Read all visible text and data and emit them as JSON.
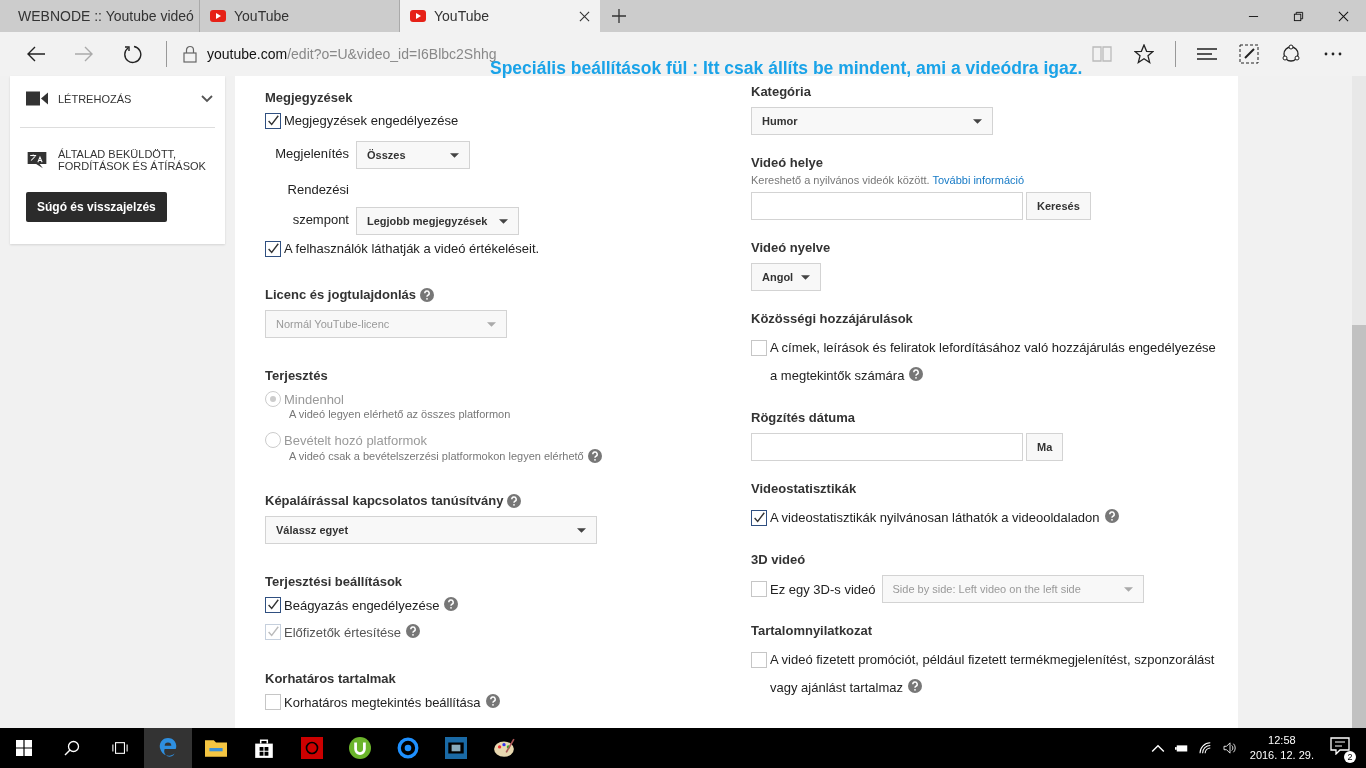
{
  "browser": {
    "tabs": [
      {
        "title": "WEBNODE :: Youtube videó",
        "kind": "webnode",
        "selected": false
      },
      {
        "title": "YouTube",
        "kind": "youtube",
        "selected": false
      },
      {
        "title": "YouTube",
        "kind": "youtube",
        "selected": true
      }
    ],
    "address": {
      "host": "youtube.com",
      "path": "/edit?o=U&video_id=I6Blbc2Shhg"
    }
  },
  "annotation": "Speciális beállítások fül : Itt csak állíts be mindent, ami a videódra igaz.",
  "sidebar": {
    "items": [
      {
        "label": "LÉTREHOZÁS",
        "kind": "create",
        "expandable": true
      },
      {
        "label": "ÁLTALAD BEKÜLDÖTT, FORDÍTÁSOK ÉS ÁTÍRÁSOK",
        "kind": "translate"
      }
    ],
    "help_button": "Súgó és visszajelzés"
  },
  "columns": [
    [
      {
        "title": "Megjegyzések",
        "controls": [
          {
            "kind": "checkbox",
            "label": "Megjegyzések engedélyezése",
            "checked": true
          },
          {
            "kind": "labeled_select",
            "label": "Megjelenítés",
            "value": "Összes"
          },
          {
            "kind": "labeled_select",
            "label": "Rendezési szempont",
            "value": "Legjobb megjegyzések"
          },
          {
            "kind": "checkbox",
            "label": "A felhasználók láthatják a videó értékeléseit.",
            "checked": true
          }
        ]
      },
      {
        "title": "Licenc és jogtulajdonlás",
        "help": true,
        "controls": [
          {
            "kind": "select",
            "value": "Normál YouTube-licenc",
            "disabled": true
          }
        ]
      },
      {
        "title": "Terjesztés",
        "controls": [
          {
            "kind": "radio",
            "label": "Mindenhol",
            "description": "A videó legyen elérhető az összes platformon",
            "selected": true,
            "disabled": true
          },
          {
            "kind": "radio",
            "label": "Bevételt hozó platformok",
            "description": "A videó csak a bevételszerzési platformokon legyen elérhető",
            "selected": false,
            "disabled": true,
            "help": true
          }
        ]
      },
      {
        "title": "Képaláírással kapcsolatos tanúsítvány",
        "help": true,
        "controls": [
          {
            "kind": "select",
            "value": "Válassz egyet",
            "wide": true
          }
        ]
      },
      {
        "title": "Terjesztési beállítások",
        "controls": [
          {
            "kind": "checkbox",
            "label": "Beágyazás engedélyezése",
            "checked": true,
            "help": true
          },
          {
            "kind": "checkbox",
            "label": "Előfizetők értesítése",
            "checked": true,
            "disabled": true,
            "help": true
          }
        ]
      },
      {
        "title": "Korhatáros tartalmak",
        "controls": [
          {
            "kind": "checkbox",
            "label": "Korhatáros megtekintés beállítása",
            "checked": false,
            "help": true
          }
        ]
      }
    ],
    [
      {
        "title": "Kategória",
        "controls": [
          {
            "kind": "select",
            "value": "Humor"
          }
        ]
      },
      {
        "title": "Videó helye",
        "controls": [
          {
            "kind": "note",
            "text": "Kereshető a nyilvános videók között.",
            "link": "További információ"
          },
          {
            "kind": "field_button",
            "button": "Keresés"
          }
        ]
      },
      {
        "title": "Videó nyelve",
        "controls": [
          {
            "kind": "small_select",
            "value": "Angol"
          }
        ]
      },
      {
        "title": "Közösségi hozzájárulások",
        "controls": [
          {
            "kind": "checkbox",
            "label": "A címek, leírások és feliratok lefordításához való hozzájárulás engedélyezése a megtekintők számára",
            "checked": false,
            "help": true
          }
        ]
      },
      {
        "title": "Rögzítés dátuma",
        "controls": [
          {
            "kind": "field_button",
            "button": "Ma"
          }
        ]
      },
      {
        "title": "Videostatisztikák",
        "controls": [
          {
            "kind": "checkbox",
            "label": "A videostatisztikák nyilvánosan láthatók a videooldaladon",
            "checked": true,
            "help": true
          }
        ]
      },
      {
        "title": "3D videó",
        "controls": [
          {
            "kind": "checkbox_select",
            "label": "Ez egy 3D-s videó",
            "checked": false,
            "value": "Side by side: Left video on the left side"
          }
        ]
      },
      {
        "title": "Tartalomnyilatkozat",
        "controls": [
          {
            "kind": "checkbox",
            "label": "A videó fizetett promóciót, például fizetett termékmegjelenítést, szponzorálást vagy ajánlást tartalmaz",
            "checked": false,
            "help": true
          }
        ]
      }
    ]
  ],
  "taskbar": {
    "time": "12:58",
    "date": "2016. 12. 29.",
    "notifications": "2"
  }
}
